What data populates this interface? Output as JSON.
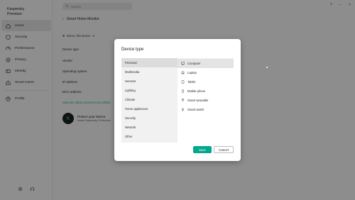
{
  "app": {
    "brand_line1": "Kaspersky",
    "brand_line2": "Premium"
  },
  "sidebar": {
    "items": [
      {
        "label": "Home",
        "icon": "home-icon"
      },
      {
        "label": "Security",
        "icon": "shield-icon"
      },
      {
        "label": "Performance",
        "icon": "performance-icon"
      },
      {
        "label": "Privacy",
        "icon": "privacy-icon"
      },
      {
        "label": "Identity",
        "icon": "identity-icon"
      },
      {
        "label": "Smart Home",
        "icon": "smart-home-icon"
      },
      {
        "label": "Profile",
        "icon": "profile-icon"
      }
    ]
  },
  "topbar": {
    "search_placeholder": "Search",
    "help": "?",
    "minimize": "–",
    "close": "×"
  },
  "main": {
    "back_title": "Smart Home Monitor",
    "device_label": "Demo, this device",
    "props": [
      "Device type",
      "Vendor",
      "Operating system",
      "IP address",
      "MAC address"
    ],
    "help_link": "How do I deny access to an unfam",
    "promo_title": "Protect your device",
    "promo_sub": "Install Kaspersky Protection"
  },
  "dialog": {
    "title": "Device type",
    "categories": [
      "Personal",
      "Multimedia",
      "Sensors",
      "Lighting",
      "Climate",
      "Home appliances",
      "Security",
      "Network",
      "Other"
    ],
    "selected_category": "Personal",
    "devices": [
      {
        "label": "Computer",
        "icon": "computer-icon"
      },
      {
        "label": "Laptop",
        "icon": "laptop-icon"
      },
      {
        "label": "Tablet",
        "icon": "tablet-icon"
      },
      {
        "label": "Mobile phone",
        "icon": "mobile-phone-icon"
      },
      {
        "label": "Smart wearable",
        "icon": "smart-wearable-icon"
      },
      {
        "label": "Smart watch",
        "icon": "smart-watch-icon"
      }
    ],
    "selected_device": "Computer",
    "save_label": "Save",
    "cancel_label": "Cancel"
  },
  "colors": {
    "accent": "#00a88e",
    "overlay": "#000000"
  }
}
